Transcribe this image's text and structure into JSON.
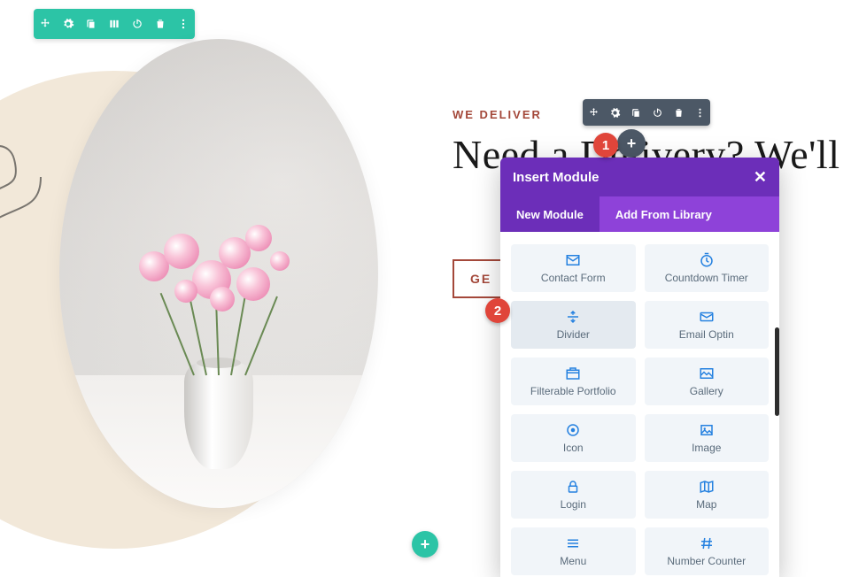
{
  "eyebrow": "WE DELIVER",
  "headline": "Need a Delivery? We'll",
  "cta_label": "GE",
  "top_toolbar": {
    "icons": [
      "move-icon",
      "settings-icon",
      "duplicate-icon",
      "columns-icon",
      "power-icon",
      "trash-icon",
      "more-icon"
    ]
  },
  "module_toolbar": {
    "icons": [
      "move-icon",
      "settings-icon",
      "duplicate-icon",
      "power-icon",
      "trash-icon",
      "more-icon"
    ]
  },
  "steps": {
    "one": "1",
    "two": "2"
  },
  "modal": {
    "title": "Insert Module",
    "close": "✕",
    "tabs": {
      "new": "New Module",
      "library": "Add From Library",
      "active": "new"
    },
    "items": [
      {
        "icon": "contact-form-icon",
        "label": "Contact Form"
      },
      {
        "icon": "countdown-timer-icon",
        "label": "Countdown Timer"
      },
      {
        "icon": "divider-icon",
        "label": "Divider",
        "hover": true
      },
      {
        "icon": "email-optin-icon",
        "label": "Email Optin"
      },
      {
        "icon": "filterable-portfolio-icon",
        "label": "Filterable Portfolio"
      },
      {
        "icon": "gallery-icon",
        "label": "Gallery"
      },
      {
        "icon": "icon-icon",
        "label": "Icon"
      },
      {
        "icon": "image-icon",
        "label": "Image"
      },
      {
        "icon": "login-icon",
        "label": "Login"
      },
      {
        "icon": "map-icon",
        "label": "Map"
      },
      {
        "icon": "menu-icon",
        "label": "Menu"
      },
      {
        "icon": "number-counter-icon",
        "label": "Number Counter"
      }
    ]
  }
}
